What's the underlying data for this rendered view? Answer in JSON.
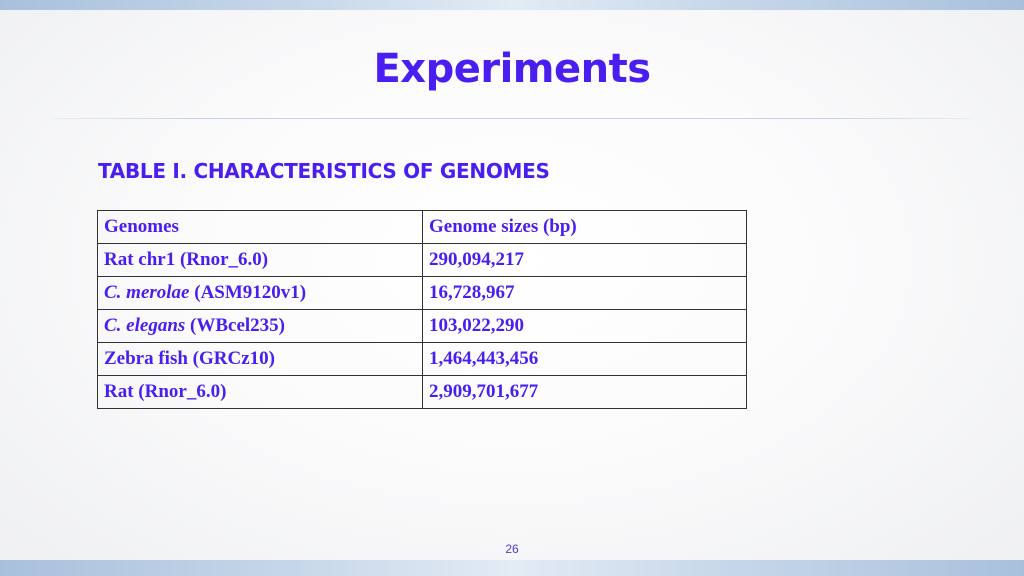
{
  "slide": {
    "title": "Experiments",
    "page_number": "26"
  },
  "table": {
    "caption": "TABLE I. CHARACTERISTICS OF GENOMES",
    "headers": [
      "Genomes",
      "Genome sizes (bp)"
    ],
    "rows": [
      {
        "species": "",
        "name": "Rat chr1 (Rnor_6.0)",
        "size": "290,094,217"
      },
      {
        "species": "C. merolae",
        "name": " (ASM9120v1)",
        "size": "16,728,967"
      },
      {
        "species": "C. elegans",
        "name": " (WBcel235)",
        "size": "103,022,290"
      },
      {
        "species": "",
        "name": "Zebra fish (GRCz10)",
        "size": "1,464,443,456"
      },
      {
        "species": "",
        "name": "Rat (Rnor_6.0)",
        "size": "2,909,701,677"
      }
    ]
  },
  "colors": {
    "accent": "#4a1ef0",
    "border": "#333333"
  }
}
